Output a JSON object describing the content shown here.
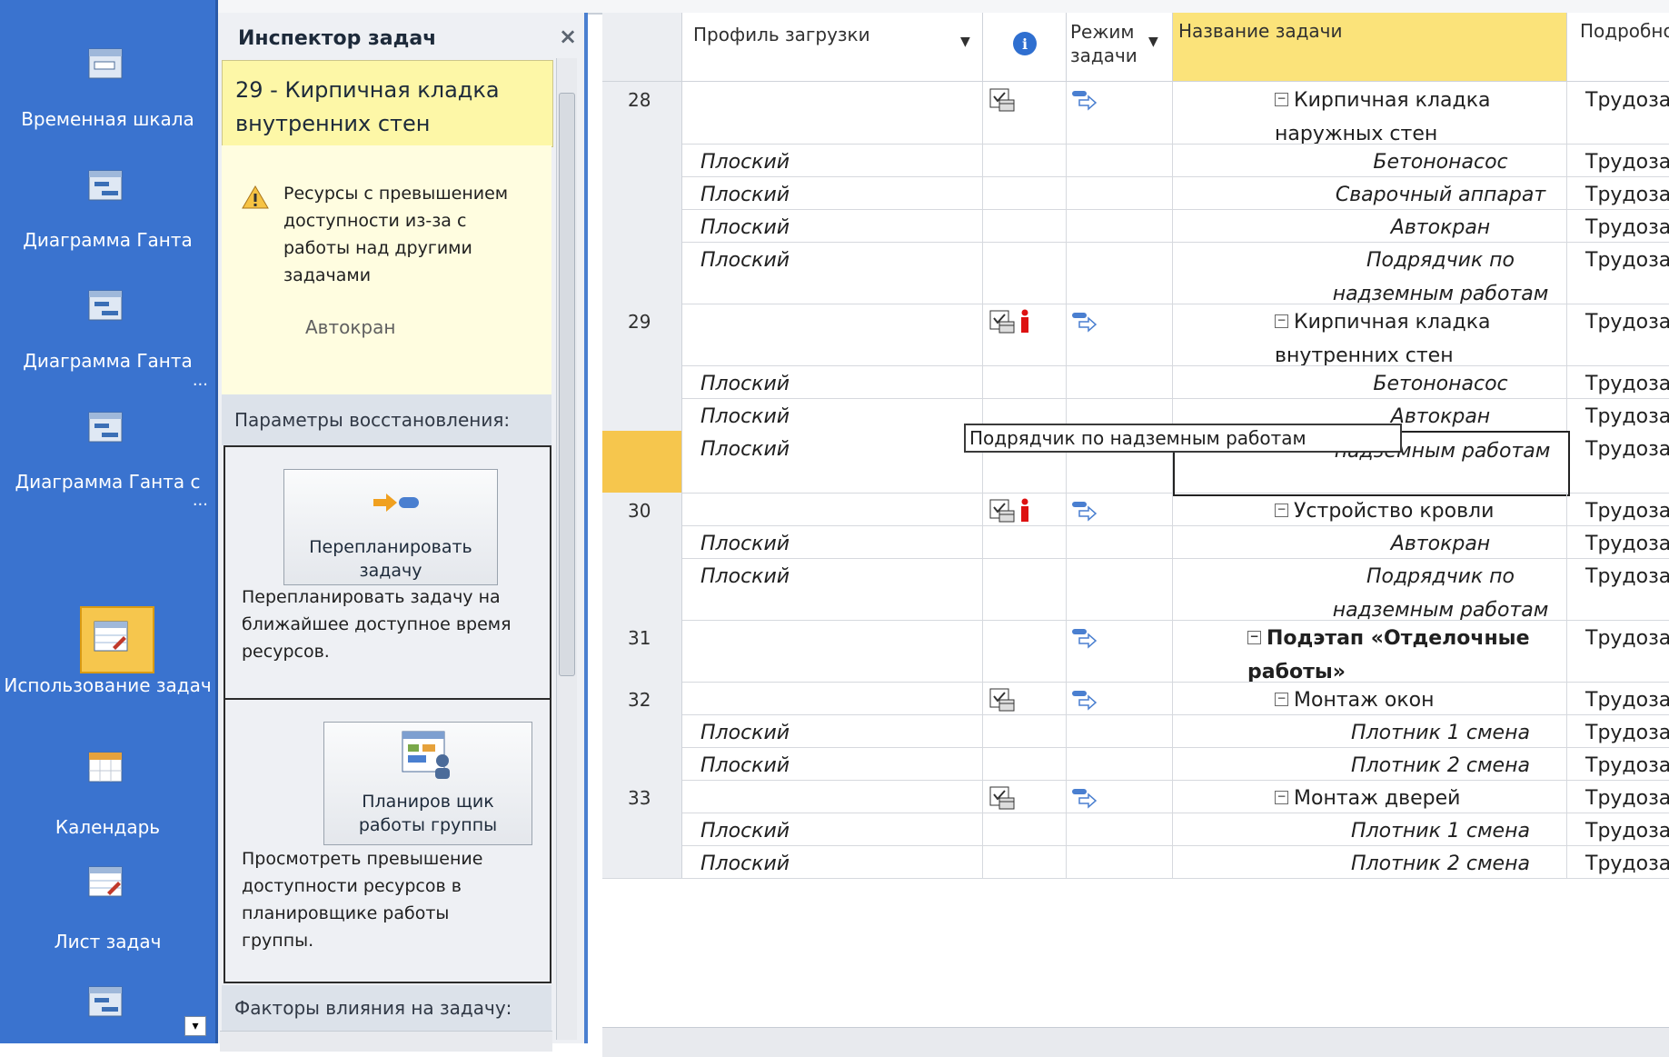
{
  "viewbar": {
    "items": [
      {
        "label": "Временная шкала",
        "icon": "timeline-icon"
      },
      {
        "label": "Диаграмма Ганта",
        "icon": "gantt-chart-icon"
      },
      {
        "label": "Диаграмма Ганта",
        "icon": "gantt-chart-icon"
      },
      {
        "label": "Диаграмма Ганта с",
        "icon": "gantt-chart-icon"
      },
      {
        "label": "Использование задач",
        "icon": "task-usage-icon"
      },
      {
        "label": "Календарь",
        "icon": "calendar-icon"
      },
      {
        "label": "Лист задач",
        "icon": "task-sheet-icon"
      }
    ],
    "more": "..."
  },
  "inspector": {
    "title": "Инспектор задач",
    "close": "×",
    "task": "29 - Кирпичная кладка внутренних стен",
    "warning_text": "Ресурсы с превышением доступности из-за с работы над другими задачами",
    "warning_resource": "Автокран",
    "section_restore": "Параметры восстановления:",
    "reschedule_button": "Перепланировать задачу",
    "reschedule_desc": "Перепланировать задачу на ближайшее доступное время ресурсов.",
    "planner_button": "Планиров щик работы группы",
    "planner_desc": "Просмотреть превышение доступности ресурсов в планировщике работы группы.",
    "section_factors": "Факторы влияния на задачу:"
  },
  "grid": {
    "headers": {
      "profile": "Профиль загрузки",
      "info": "i",
      "mode": "Режим задачи",
      "name": "Название задачи",
      "details": "Подробности"
    },
    "tooltip": "Подрядчик по надземным работам",
    "rows": [
      {
        "id": "28",
        "profile": "",
        "name": "Кирпичная кладка наружных стен",
        "details": "Трудозатр."
      },
      {
        "id": "",
        "profile": "Плоский",
        "name": "Бетононасос",
        "details": "Трудозатр."
      },
      {
        "id": "",
        "profile": "Плоский",
        "name": "Сварочный аппарат",
        "details": "Трудозатр."
      },
      {
        "id": "",
        "profile": "Плоский",
        "name": "Автокран",
        "details": "Трудозатр."
      },
      {
        "id": "",
        "profile": "Плоский",
        "name": "Подрядчик по надземным работам",
        "details": "Трудозатр. ("
      },
      {
        "id": "29",
        "profile": "",
        "name": "Кирпичная кладка внутренних стен",
        "details": "Трудозатр."
      },
      {
        "id": "",
        "profile": "Плоский",
        "name": "Бетононасос",
        "details": "Трудозатр."
      },
      {
        "id": "",
        "profile": "Плоский",
        "name": "Автокран",
        "details": "Трудозатр."
      },
      {
        "id": "",
        "profile": "Плоский",
        "name": "надземным работам",
        "details": "Трудозатр. ("
      },
      {
        "id": "30",
        "profile": "",
        "name": "Устройство кровли",
        "details": "Трудозатр."
      },
      {
        "id": "",
        "profile": "Плоский",
        "name": "Автокран",
        "details": "Трудозатр."
      },
      {
        "id": "",
        "profile": "Плоский",
        "name": "Подрядчик по надземным работам",
        "details": "Трудозатр. ("
      },
      {
        "id": "31",
        "profile": "",
        "name": "Подэтап «Отделочные работы»",
        "details": "Трудозатр."
      },
      {
        "id": "32",
        "profile": "",
        "name": "Монтаж окон",
        "details": "Трудозатр."
      },
      {
        "id": "",
        "profile": "Плоский",
        "name": "Плотник 1 смена",
        "details": "Трудозатр."
      },
      {
        "id": "",
        "profile": "Плоский",
        "name": "Плотник 2 смена",
        "details": "Трудозатр."
      },
      {
        "id": "33",
        "profile": "",
        "name": "Монтаж дверей",
        "details": "Трудозатр."
      },
      {
        "id": "",
        "profile": "Плоский",
        "name": "Плотник 1 смена",
        "details": "Трудозатр."
      },
      {
        "id": "",
        "profile": "Плоский",
        "name": "Плотник 2 смена",
        "details": "Трудозатр."
      }
    ]
  },
  "colors": {
    "viewbar": "#3a73cf",
    "active": "#f6c64d",
    "task_highlight": "#fdf7a7",
    "name_header": "#fbe37a"
  }
}
